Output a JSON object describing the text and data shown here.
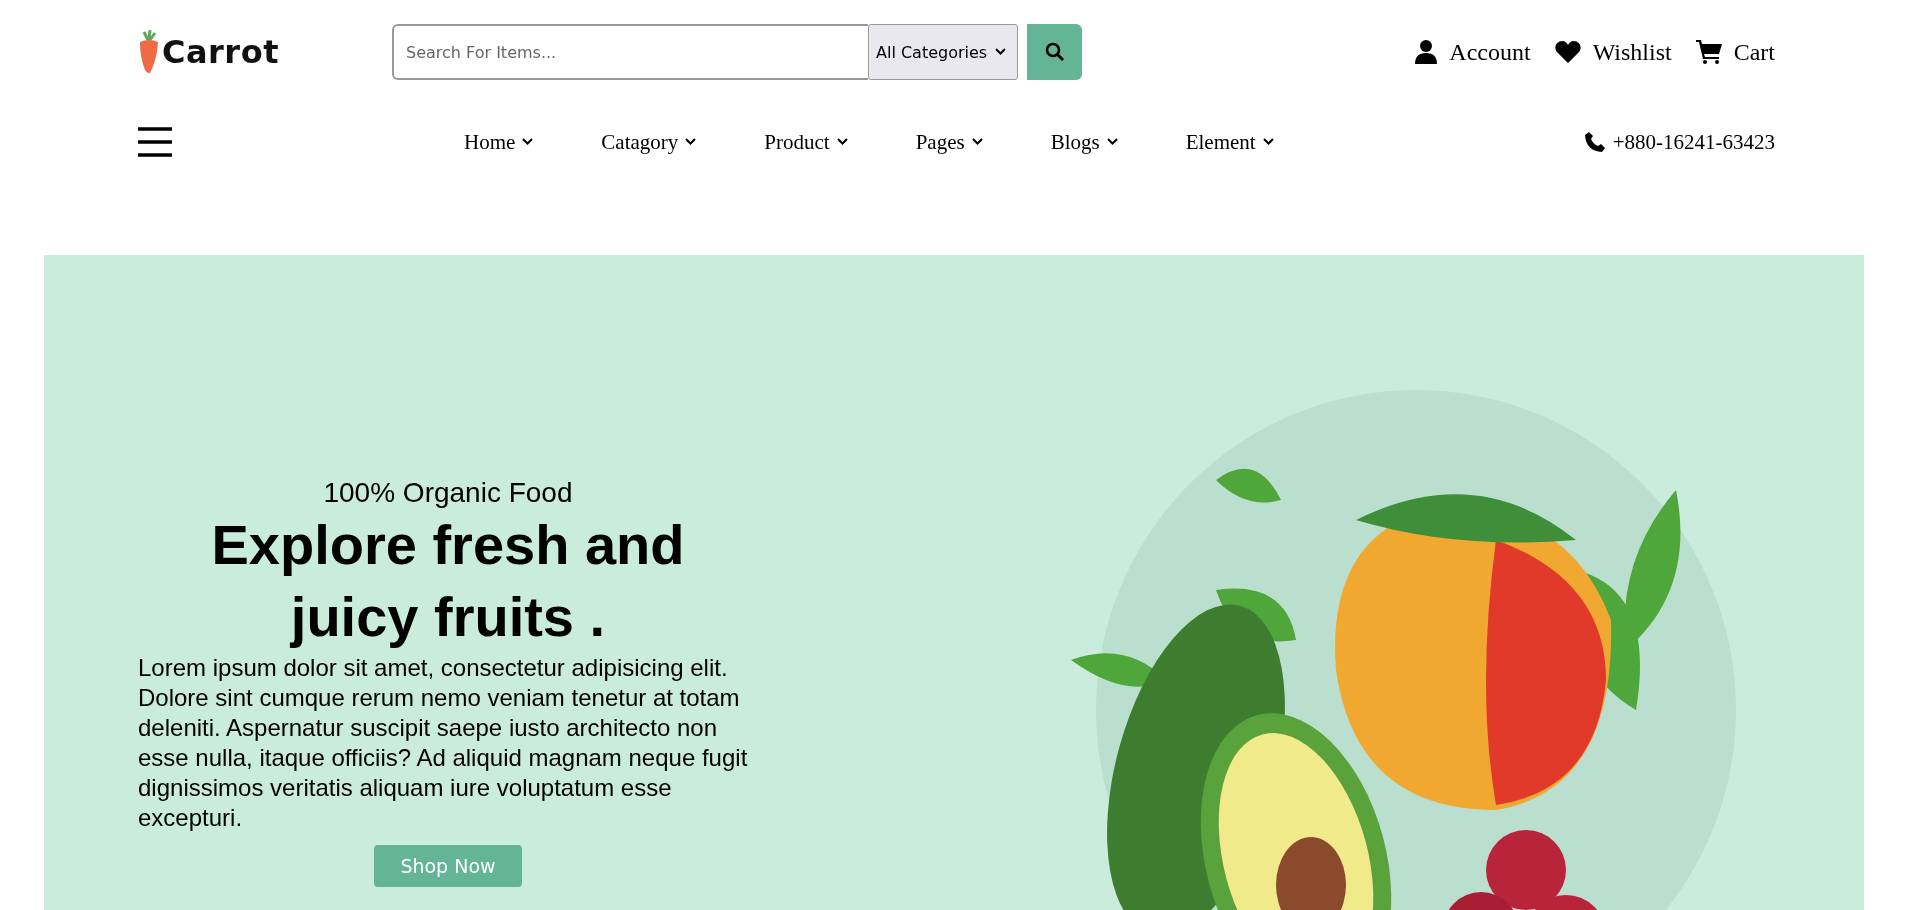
{
  "logo": {
    "text": "Carrot"
  },
  "search": {
    "placeholder": "Search For Items...",
    "category": "All Categories"
  },
  "header_links": [
    {
      "label": "Account",
      "kind": "user"
    },
    {
      "label": "Wishlist",
      "kind": "heart"
    },
    {
      "label": "Cart",
      "kind": "cart"
    }
  ],
  "nav": [
    {
      "label": "Home"
    },
    {
      "label": "Catagory"
    },
    {
      "label": "Product"
    },
    {
      "label": "Pages"
    },
    {
      "label": "Blogs"
    },
    {
      "label": "Element"
    }
  ],
  "phone": "+880-16241-63423",
  "hero": {
    "eyebrow": "100% Organic Food",
    "title": "Explore fresh and juicy fruits .",
    "text": "Lorem ipsum dolor sit amet, consectetur adipisicing elit. Dolore sint cumque rerum nemo veniam tenetur at totam deleniti. Aspernatur suscipit saepe iusto architecto non esse nulla, itaque officiis? Ad aliquid magnam neque fugit dignissimos veritatis aliquam iure voluptatum esse excepturi.",
    "button": "Shop Now"
  }
}
